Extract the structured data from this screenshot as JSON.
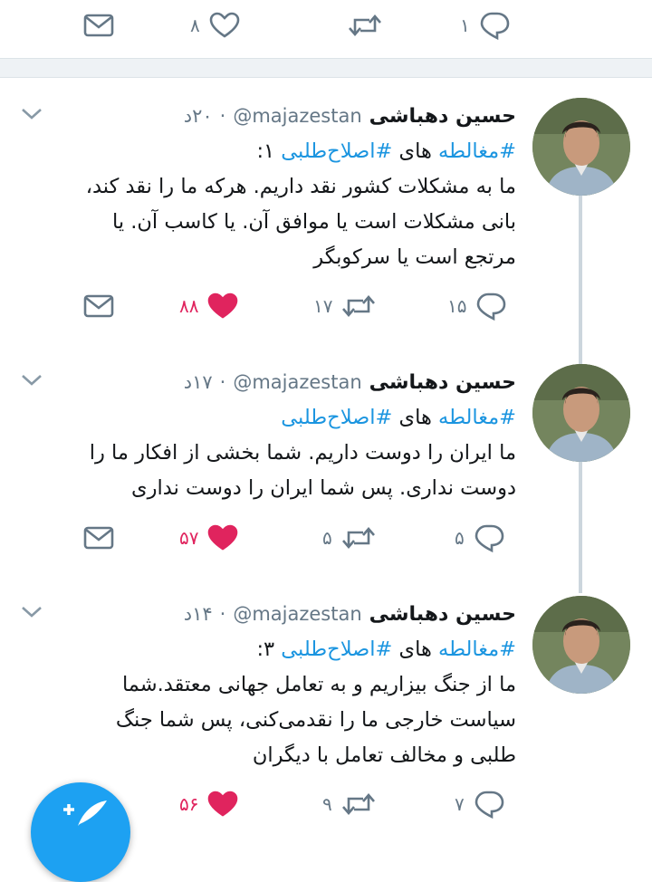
{
  "top_bar": {
    "reply_count": "۱",
    "like_count": "۸"
  },
  "tweets": [
    {
      "name": "حسین دهباشی",
      "handle": "@majazestan",
      "time": "۲۰د",
      "tag1": "#مغالطه",
      "word": "های",
      "tag2": "#اصلاح‌طلبی",
      "suffix": "۱:",
      "lines": [
        "ما به مشکلات کشور نقد داریم. هرکه ما را نقد کند،",
        "بانی مشکلات است یا موافق آن. یا کاسب آن. یا",
        "مرتجع است یا سرکوبگر"
      ],
      "reply_count": "۱۵",
      "retweet_count": "۱۷",
      "like_count": "۸۸"
    },
    {
      "name": "حسین دهباشی",
      "handle": "@majazestan",
      "time": "۱۷د",
      "tag1": "#مغالطه",
      "word": "های",
      "tag2": "#اصلاح‌طلبی",
      "suffix": "",
      "lines": [
        "ما ایران را دوست داریم. شما بخشی از افکار ما را",
        "دوست نداری. پس شما ایران را دوست نداری"
      ],
      "reply_count": "۵",
      "retweet_count": "۵",
      "like_count": "۵۷"
    },
    {
      "name": "حسین دهباشی",
      "handle": "@majazestan",
      "time": "۱۴د",
      "tag1": "#مغالطه",
      "word": "های",
      "tag2": "#اصلاح‌طلبی",
      "suffix": "۳:",
      "lines": [
        "ما از جنگ بیزاریم و به تعامل جهانی معتقد.شما",
        "سیاست خارجی ما را نقدمی‌کنی، پس شما جنگ",
        "طلبی و مخالف تعامل با دیگران"
      ],
      "reply_count": "۷",
      "retweet_count": "۹",
      "like_count": "۵۶"
    }
  ],
  "colors": {
    "accent": "#1b95e0",
    "like": "#e0245e",
    "meta": "#657786",
    "fab": "#1da1f2"
  },
  "icons": [
    "mail-icon",
    "heart-icon",
    "retweet-icon",
    "reply-icon",
    "chevron-down-icon",
    "compose-icon"
  ]
}
